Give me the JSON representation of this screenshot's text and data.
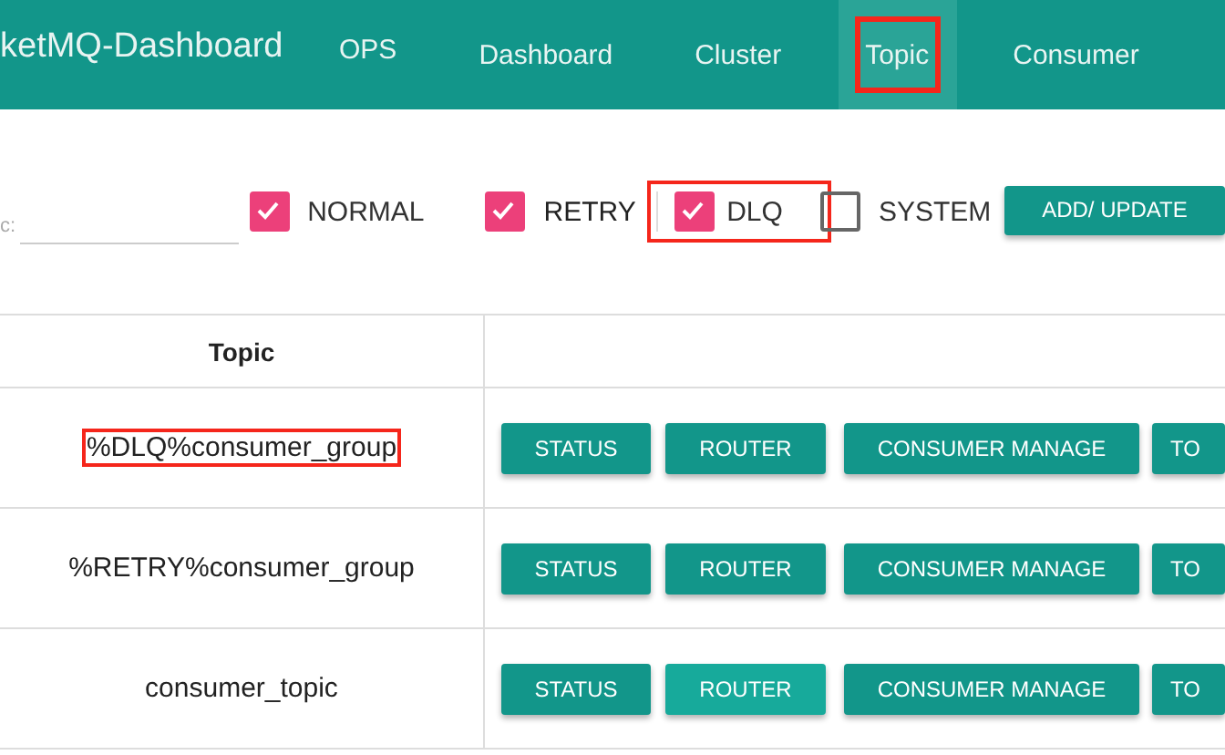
{
  "header": {
    "brand": "ketMQ-Dashboard",
    "nav": [
      {
        "label": "OPS",
        "selected": false,
        "highlighted": false
      },
      {
        "label": "Dashboard",
        "selected": false,
        "highlighted": false
      },
      {
        "label": "Cluster",
        "selected": false,
        "highlighted": false
      },
      {
        "label": "Topic",
        "selected": true,
        "highlighted": true
      },
      {
        "label": "Consumer",
        "selected": false,
        "highlighted": false
      }
    ]
  },
  "filter": {
    "label": "c:",
    "checkboxes": [
      {
        "label": "NORMAL",
        "checked": true,
        "highlighted": false
      },
      {
        "label": "RETRY",
        "checked": true,
        "highlighted": false
      },
      {
        "label": "DLQ",
        "checked": true,
        "highlighted": true
      },
      {
        "label": "SYSTEM",
        "checked": false,
        "highlighted": false
      }
    ],
    "button": "ADD/ UPDATE"
  },
  "table": {
    "columns": [
      "Topic"
    ],
    "rows": [
      {
        "topic": "%DLQ%consumer_group",
        "highlighted": true,
        "buttons": [
          {
            "label": "STATUS",
            "hover": false
          },
          {
            "label": "ROUTER",
            "hover": false
          },
          {
            "label": "CONSUMER MANAGE",
            "hover": false
          },
          {
            "label": "TO",
            "hover": false
          }
        ]
      },
      {
        "topic": "%RETRY%consumer_group",
        "highlighted": false,
        "buttons": [
          {
            "label": "STATUS",
            "hover": false
          },
          {
            "label": "ROUTER",
            "hover": false
          },
          {
            "label": "CONSUMER MANAGE",
            "hover": false
          },
          {
            "label": "TO",
            "hover": false
          }
        ]
      },
      {
        "topic": "consumer_topic",
        "highlighted": false,
        "buttons": [
          {
            "label": "STATUS",
            "hover": false
          },
          {
            "label": "ROUTER",
            "hover": true
          },
          {
            "label": "CONSUMER MANAGE",
            "hover": false
          },
          {
            "label": "TO",
            "hover": false
          }
        ]
      }
    ]
  }
}
